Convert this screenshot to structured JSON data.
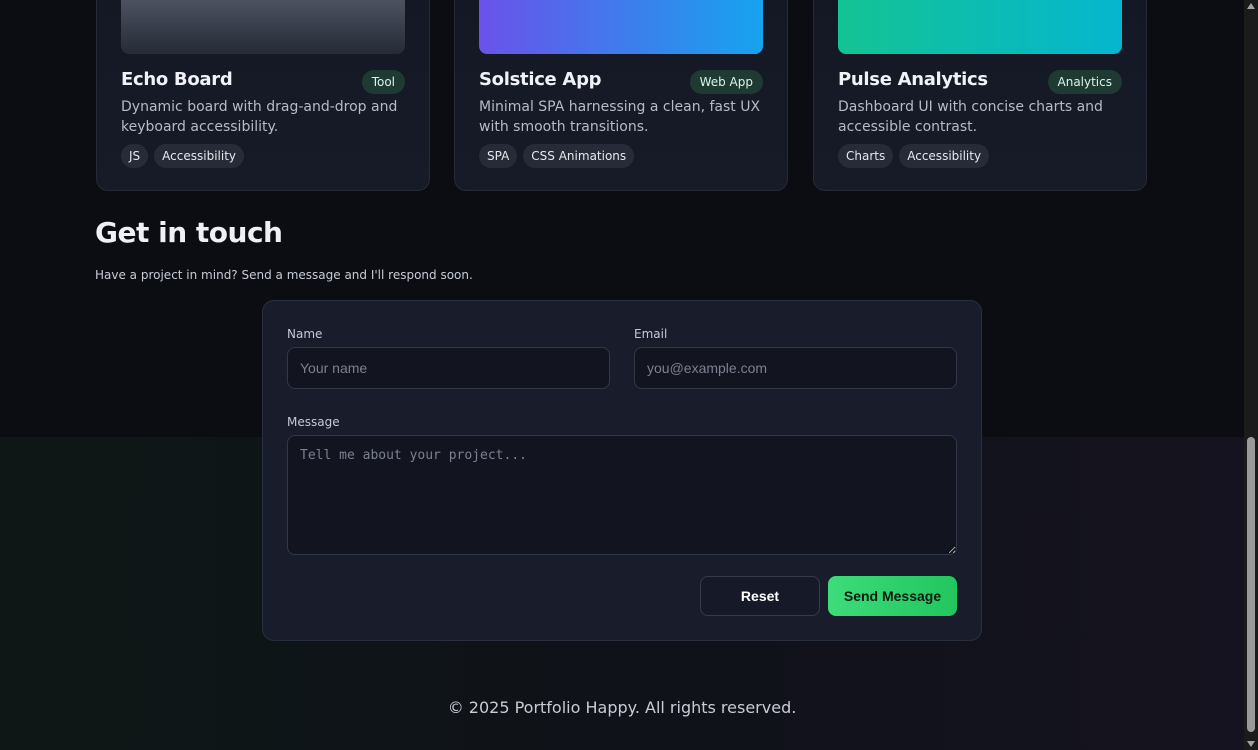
{
  "projects": [
    {
      "title": "Echo Board",
      "badge": "Tool",
      "description": "Dynamic board with drag-and-drop and keyboard accessibility.",
      "tags": [
        "JS",
        "Accessibility"
      ],
      "thumb_gradient": [
        "#5a6070",
        "#252a36"
      ]
    },
    {
      "title": "Solstice App",
      "badge": "Web App",
      "description": "Minimal SPA harnessing a clean, fast UX with smooth transitions.",
      "tags": [
        "SPA",
        "CSS Animations"
      ],
      "thumb_gradient": [
        "#6a52ea",
        "#16a4ee"
      ]
    },
    {
      "title": "Pulse Analytics",
      "badge": "Analytics",
      "description": "Dashboard UI with concise charts and accessible contrast.",
      "tags": [
        "Charts",
        "Accessibility"
      ],
      "thumb_gradient": [
        "#14c393",
        "#05b6d0"
      ]
    }
  ],
  "contact": {
    "title": "Get in touch",
    "subtitle": "Have a project in mind? Send a message and I'll respond soon.",
    "name_label": "Name",
    "name_placeholder": "Your name",
    "email_label": "Email",
    "email_placeholder": "you@example.com",
    "message_label": "Message",
    "message_placeholder": "Tell me about your project...",
    "reset_label": "Reset",
    "send_label": "Send Message"
  },
  "footer": {
    "text": "© 2025 Portfolio Happy. All rights reserved."
  },
  "colors": {
    "accent": "#22c55e",
    "background": "#0b0d12",
    "card": "#191d2b"
  }
}
